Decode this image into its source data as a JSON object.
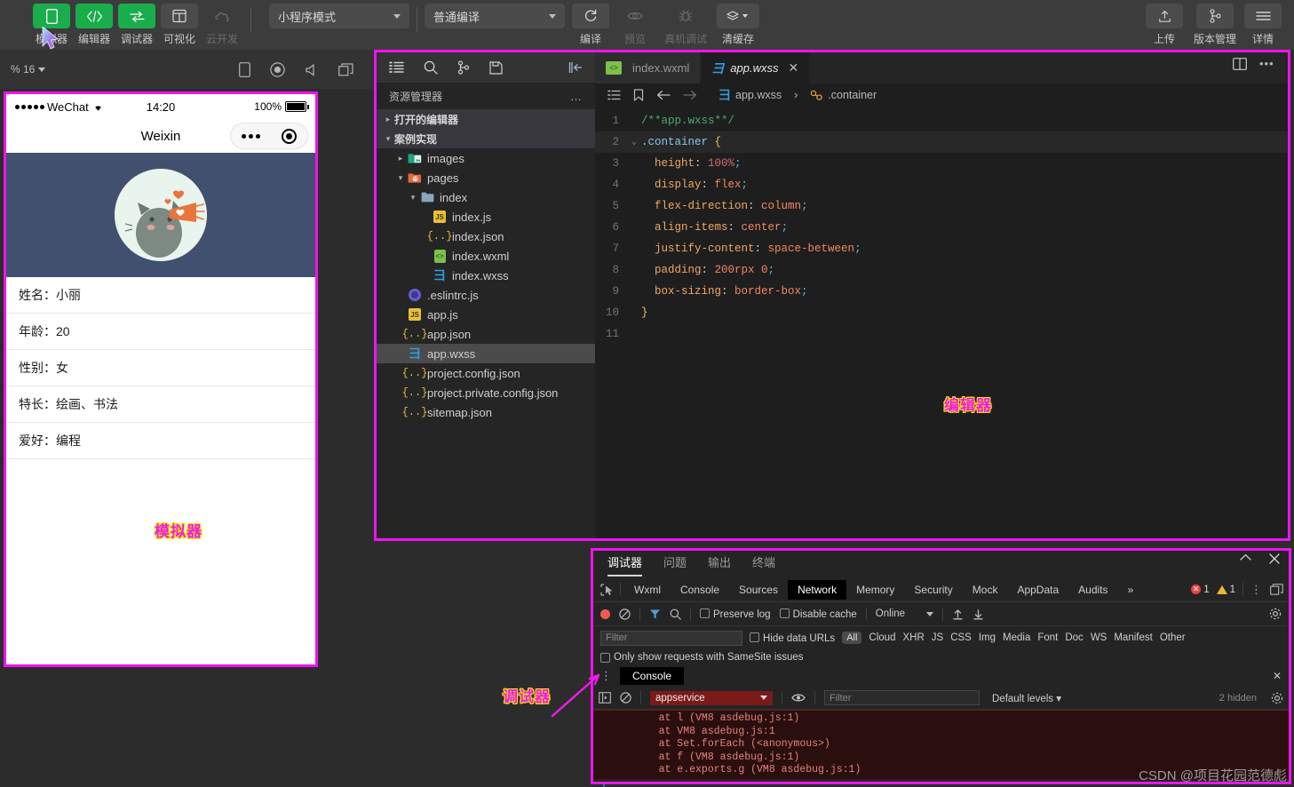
{
  "toolbar": {
    "items": [
      {
        "label": "模拟器",
        "icon": "phone-icon",
        "style": "green"
      },
      {
        "label": "编辑器",
        "icon": "code-icon",
        "style": "green"
      },
      {
        "label": "调试器",
        "icon": "debug-icon",
        "style": "green"
      },
      {
        "label": "可视化",
        "icon": "layout-icon",
        "style": "grey"
      },
      {
        "label": "云开发",
        "icon": "cloud-icon",
        "style": "dim"
      }
    ],
    "mode_select": "小程序模式",
    "compile_select": "普通编译",
    "actions": [
      {
        "label": "编译",
        "icon": "refresh-icon",
        "dim": false
      },
      {
        "label": "预览",
        "icon": "eye-icon",
        "dim": true
      },
      {
        "label": "真机调试",
        "icon": "bug-icon",
        "dim": true
      },
      {
        "label": "清缓存",
        "icon": "layers-icon",
        "dim": false
      }
    ],
    "right_actions": [
      {
        "label": "上传",
        "icon": "upload-icon"
      },
      {
        "label": "版本管理",
        "icon": "branch-icon"
      },
      {
        "label": "详情",
        "icon": "menu-icon"
      }
    ]
  },
  "simulator": {
    "zoom_label": "% 16",
    "bar_icons": [
      "device-icon",
      "record-icon",
      "volume-icon",
      "windows-icon"
    ],
    "status": {
      "carrier": "WeChat",
      "time": "14:20",
      "battery": "100%"
    },
    "nav_title": "Weixin",
    "list": [
      "姓名：小丽",
      "年龄：20",
      "性别：女",
      "特长：绘画、书法",
      "爱好：编程"
    ],
    "annotation": "模拟器"
  },
  "explorer": {
    "activity_icons": [
      "files-icon",
      "search-icon",
      "source-control-icon",
      "save-icon",
      "collapse-icon"
    ],
    "title": "资源管理器",
    "more": "…",
    "tree": [
      {
        "label": "打开的编辑器",
        "depth": 0,
        "kind": "section",
        "twisty": "▸"
      },
      {
        "label": "案例实现",
        "depth": 0,
        "kind": "section",
        "twisty": "▾"
      },
      {
        "label": "images",
        "depth": 1,
        "kind": "folder-images",
        "twisty": "▸"
      },
      {
        "label": "pages",
        "depth": 1,
        "kind": "folder-pages",
        "twisty": "▾"
      },
      {
        "label": "index",
        "depth": 2,
        "kind": "folder",
        "twisty": "▾"
      },
      {
        "label": "index.js",
        "depth": 3,
        "kind": "js",
        "twisty": ""
      },
      {
        "label": "index.json",
        "depth": 3,
        "kind": "json",
        "twisty": ""
      },
      {
        "label": "index.wxml",
        "depth": 3,
        "kind": "wxml",
        "twisty": ""
      },
      {
        "label": "index.wxss",
        "depth": 3,
        "kind": "wxss",
        "twisty": ""
      },
      {
        "label": ".eslintrc.js",
        "depth": 1,
        "kind": "eslint",
        "twisty": ""
      },
      {
        "label": "app.js",
        "depth": 1,
        "kind": "js",
        "twisty": ""
      },
      {
        "label": "app.json",
        "depth": 1,
        "kind": "json",
        "twisty": ""
      },
      {
        "label": "app.wxss",
        "depth": 1,
        "kind": "wxss",
        "twisty": "",
        "selected": true
      },
      {
        "label": "project.config.json",
        "depth": 1,
        "kind": "json",
        "twisty": ""
      },
      {
        "label": "project.private.config.json",
        "depth": 1,
        "kind": "json",
        "twisty": ""
      },
      {
        "label": "sitemap.json",
        "depth": 1,
        "kind": "json",
        "twisty": ""
      }
    ]
  },
  "editor": {
    "tabs": [
      {
        "label": "index.wxml",
        "kind": "wxml",
        "active": false
      },
      {
        "label": "app.wxss",
        "kind": "wxss",
        "active": true,
        "close": "✕"
      }
    ],
    "breadcrumb": {
      "file": "app.wxss",
      "sep": "›",
      "symbol": ".container"
    },
    "right_icons": [
      "split-editor-icon",
      "more-icon"
    ],
    "code": [
      {
        "n": "1",
        "fold": "",
        "tokens": [
          {
            "t": "/**app.wxss**/",
            "c": "c-cmt"
          }
        ]
      },
      {
        "n": "2",
        "fold": "⌄",
        "hl": true,
        "tokens": [
          {
            "t": ".container ",
            "c": "c-sel"
          },
          {
            "t": "{",
            "c": "c-brace"
          }
        ]
      },
      {
        "n": "3",
        "fold": "",
        "tokens": [
          {
            "t": "  height",
            "c": "c-prop"
          },
          {
            "t": ": ",
            "c": "c-plain"
          },
          {
            "t": "100%",
            "c": "c-num"
          },
          {
            "t": ";",
            "c": "c-semi"
          }
        ]
      },
      {
        "n": "4",
        "fold": "",
        "tokens": [
          {
            "t": "  display",
            "c": "c-prop"
          },
          {
            "t": ": ",
            "c": "c-plain"
          },
          {
            "t": "flex",
            "c": "c-val"
          },
          {
            "t": ";",
            "c": "c-semi"
          }
        ]
      },
      {
        "n": "5",
        "fold": "",
        "tokens": [
          {
            "t": "  flex-direction",
            "c": "c-prop"
          },
          {
            "t": ": ",
            "c": "c-plain"
          },
          {
            "t": "column",
            "c": "c-val"
          },
          {
            "t": ";",
            "c": "c-semi"
          }
        ]
      },
      {
        "n": "6",
        "fold": "",
        "tokens": [
          {
            "t": "  align-items",
            "c": "c-prop"
          },
          {
            "t": ": ",
            "c": "c-plain"
          },
          {
            "t": "center",
            "c": "c-val"
          },
          {
            "t": ";",
            "c": "c-semi"
          }
        ]
      },
      {
        "n": "7",
        "fold": "",
        "tokens": [
          {
            "t": "  justify-content",
            "c": "c-prop"
          },
          {
            "t": ": ",
            "c": "c-plain"
          },
          {
            "t": "space-between",
            "c": "c-val"
          },
          {
            "t": ";",
            "c": "c-semi"
          }
        ]
      },
      {
        "n": "8",
        "fold": "",
        "tokens": [
          {
            "t": "  padding",
            "c": "c-prop"
          },
          {
            "t": ": ",
            "c": "c-plain"
          },
          {
            "t": "200rpx 0",
            "c": "c-val"
          },
          {
            "t": ";",
            "c": "c-semi"
          }
        ]
      },
      {
        "n": "9",
        "fold": "",
        "tokens": [
          {
            "t": "  box-sizing",
            "c": "c-prop"
          },
          {
            "t": ": ",
            "c": "c-plain"
          },
          {
            "t": "border-box",
            "c": "c-val"
          },
          {
            "t": ";",
            "c": "c-semi"
          }
        ]
      },
      {
        "n": "10",
        "fold": "",
        "tokens": [
          {
            "t": "}",
            "c": "c-brace"
          }
        ]
      },
      {
        "n": "11",
        "fold": "",
        "tokens": []
      }
    ],
    "annotation": "编辑器"
  },
  "debugger": {
    "annotation": "调试器",
    "panel_tabs": [
      "调试器",
      "问题",
      "输出",
      "终端"
    ],
    "active_panel_tab": "调试器",
    "win_buttons": [
      "collapse-icon",
      "close-icon"
    ],
    "devtool_tabs": [
      "Wxml",
      "Console",
      "Sources",
      "Network",
      "Memory",
      "Security",
      "Mock",
      "AppData",
      "Audits",
      "»"
    ],
    "active_devtool_tab": "Network",
    "error_count": "1",
    "warn_count": "1",
    "network_toolbar": {
      "preserve_log": "Preserve log",
      "disable_cache": "Disable cache",
      "throttle": "Online"
    },
    "filter_placeholder": "Filter",
    "hide_data_urls": "Hide data URLs",
    "type_all": "All",
    "resource_types": [
      "Cloud",
      "XHR",
      "JS",
      "CSS",
      "Img",
      "Media",
      "Font",
      "Doc",
      "WS",
      "Manifest",
      "Other"
    ],
    "samesite_label": "Only show requests with SameSite issues",
    "console_tab_label": "Console",
    "console": {
      "context": "appservice",
      "filter_placeholder": "Filter",
      "levels": "Default levels",
      "hidden": "2 hidden",
      "trace": [
        "    at l (VM8 asdebug.js:1)",
        "    at VM8 asdebug.js:1",
        "    at Set.forEach (<anonymous>)",
        "    at f (VM8 asdebug.js:1)",
        "    at e.exports.g (VM8 asdebug.js:1)"
      ],
      "prompt": "›"
    }
  },
  "watermark": "CSDN @项目花园范德彪",
  "colors": {
    "annotation_pink": "#ef1aef",
    "annotation_outline": "#ffe600",
    "accent_green": "#1aad4b",
    "panel_bg": "#2c2c2c",
    "editor_bg": "#1e1e1e"
  }
}
